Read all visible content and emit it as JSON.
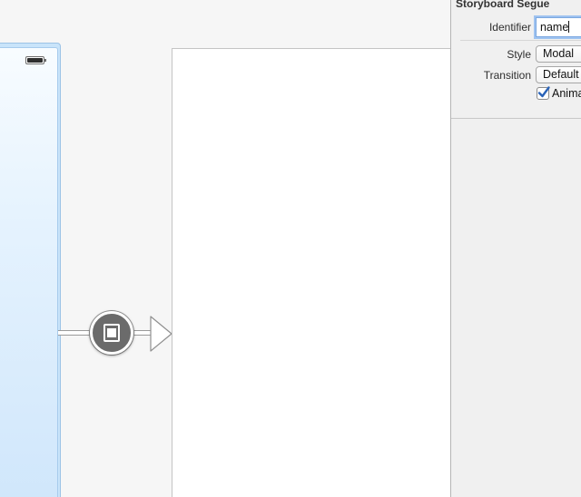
{
  "inspector": {
    "section_title": "Storyboard Segue",
    "identifier": {
      "label": "Identifier",
      "value": "name"
    },
    "style": {
      "label": "Style",
      "value": "Modal"
    },
    "transition": {
      "label": "Transition",
      "value": "Default"
    },
    "animates": {
      "label": "Animates",
      "checked": true
    }
  },
  "canvas": {
    "segue_icon": "modal-segue-icon",
    "source_scene_color": "#c9e4fa",
    "destination_scene_color": "#ffffff"
  },
  "colors": {
    "focus_ring": "#9fc3f0",
    "checkbox_check": "#2a63b8"
  }
}
